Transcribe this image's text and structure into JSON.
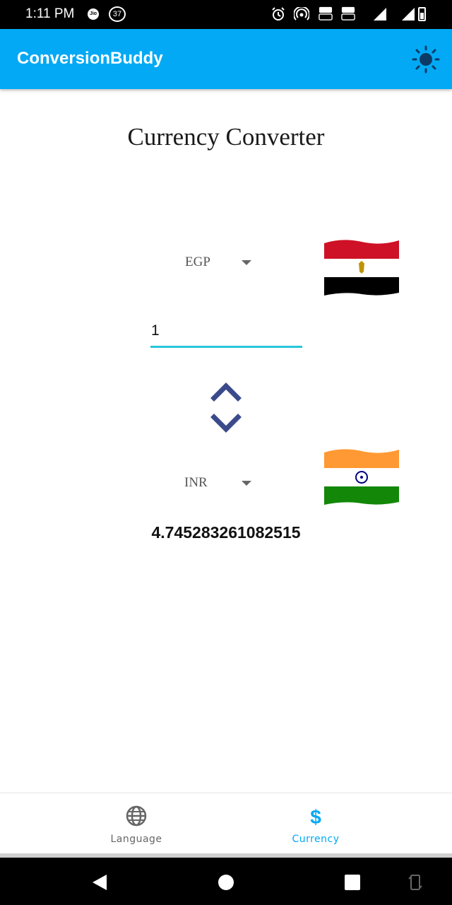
{
  "status_bar": {
    "time": "1:11 PM",
    "carrier_label": "Jio",
    "notification_count": "37",
    "volte_labels": [
      "VoLTE",
      "VoLTE"
    ]
  },
  "app_bar": {
    "title": "ConversionBuddy",
    "theme_icon": "sun-icon"
  },
  "converter": {
    "title": "Currency Converter",
    "from_currency": "EGP",
    "from_flag": "egypt-flag",
    "amount": "1",
    "to_currency": "INR",
    "to_flag": "india-flag",
    "result": "4.745283261082515",
    "swap_icons": [
      "chevron-up-icon",
      "chevron-down-icon"
    ]
  },
  "bottom_nav": {
    "items": [
      {
        "label": "Language",
        "icon": "globe-icon",
        "active": false
      },
      {
        "label": "Currency",
        "icon": "dollar-icon",
        "active": true
      }
    ],
    "active_color": "#03a9f4"
  },
  "colors": {
    "app_bar": "#03a9f4",
    "input_underline": "#26c6da",
    "chevron": "#3b4a8a"
  }
}
